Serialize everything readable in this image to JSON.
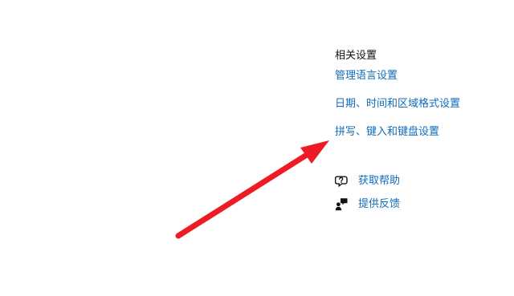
{
  "related_settings": {
    "title": "相关设置",
    "links": [
      "管理语言设置",
      "日期、时间和区域格式设置",
      "拼写、键入和键盘设置"
    ]
  },
  "support": {
    "help_label": "获取帮助",
    "feedback_label": "提供反馈",
    "help_icon": "help-chat-icon",
    "feedback_icon": "feedback-person-icon"
  },
  "colors": {
    "link": "#0f6cbd",
    "title": "#111111",
    "arrow": "#ed1c24"
  }
}
